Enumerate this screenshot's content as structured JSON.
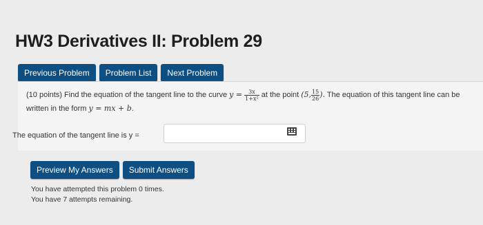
{
  "header": {
    "title": "HW3 Derivatives II: Problem 29"
  },
  "nav": {
    "previous": "Previous Problem",
    "list": "Problem List",
    "next": "Next Problem"
  },
  "problem": {
    "points": "(10 points)",
    "text_a": "Find the equation of the tangent line to the curve",
    "curve_lhs": "y =",
    "curve_num": "3x",
    "curve_den": "1+x²",
    "text_b": "at the point",
    "point_open": "(5,",
    "point_num": "15",
    "point_den": "26",
    "point_close": ").",
    "text_c": "The equation of this tangent line can be written in the form",
    "form": "y = mx + b",
    "form_end": "."
  },
  "answer": {
    "label": "The equation of the tangent line is y =",
    "value": ""
  },
  "actions": {
    "preview": "Preview My Answers",
    "submit": "Submit Answers"
  },
  "status": {
    "attempted": "You have attempted this problem 0 times.",
    "remaining": "You have 7 attempts remaining."
  },
  "icons": {
    "keyboard": "keyboard-icon"
  },
  "colors": {
    "button_bg": "#0d4f82",
    "page_bg": "#ececec"
  }
}
